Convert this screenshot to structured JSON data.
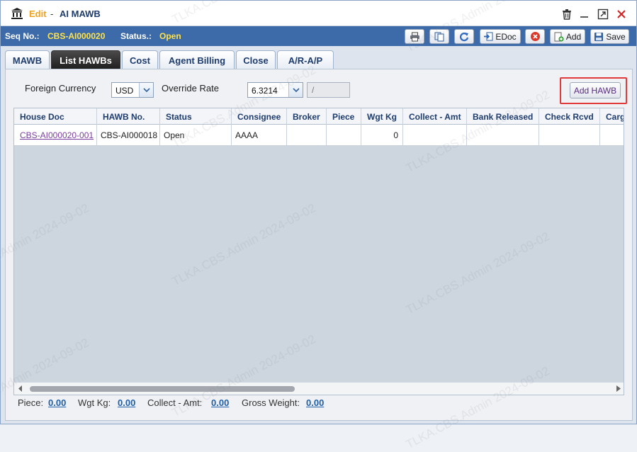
{
  "title": {
    "mode": "Edit",
    "separator": "-",
    "name": "AI MAWB"
  },
  "seq": {
    "label": "Seq No.:",
    "value": "CBS-AI000020",
    "status_label": "Status.:",
    "status_value": "Open"
  },
  "toolbar": {
    "edoc_label": "EDoc",
    "add_label": "Add",
    "save_label": "Save"
  },
  "tabs": [
    {
      "label": "MAWB",
      "active": false
    },
    {
      "label": "List HAWBs",
      "active": true
    },
    {
      "label": "Cost",
      "active": false
    },
    {
      "label": "Agent Billing",
      "active": false
    },
    {
      "label": "Close",
      "active": false
    },
    {
      "label": "A/R-A/P",
      "active": false
    }
  ],
  "filters": {
    "currency_label": "Foreign Currency",
    "currency_value": "USD",
    "rate_label": "Override Rate",
    "rate_value": "6.3214",
    "rate_secondary": "/"
  },
  "add_hawb_label": "Add HAWB",
  "grid": {
    "columns": [
      "House Doc",
      "HAWB No.",
      "Status",
      "Consignee",
      "Broker",
      "Piece",
      "Wgt Kg",
      "Collect - Amt",
      "Bank Released",
      "Check Rcvd",
      "Cargo"
    ],
    "rows": [
      {
        "house_doc": "CBS-AI000020-001",
        "hawb_no": "CBS-AI000018",
        "status": "Open",
        "consignee": "AAAA",
        "broker": "",
        "piece": "",
        "wgt_kg": "0",
        "collect_amt": "",
        "bank_released": "",
        "check_rcvd": "",
        "cargo": ""
      }
    ]
  },
  "totals": {
    "piece_label": "Piece:",
    "piece_value": "0.00",
    "wgt_label": "Wgt Kg:",
    "wgt_value": "0.00",
    "collect_label": "Collect - Amt:",
    "collect_value": "0.00",
    "gross_label": "Gross Weight:",
    "gross_value": "0.00"
  },
  "watermark": "TLKA.CBS.Admin 2024-09-02",
  "colors": {
    "seqbar": "#3d6aa8",
    "accent_yellow": "#ffe34d",
    "edit_orange": "#f0a11c",
    "highlight_red": "#e23a3a"
  }
}
